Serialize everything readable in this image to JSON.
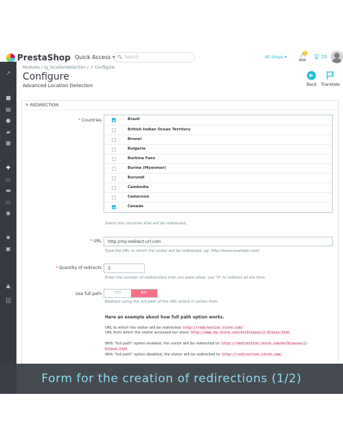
{
  "header": {
    "logo_text": "PrestaShop",
    "quick_access": "Quick Access ▾",
    "search_placeholder": "Search",
    "all_shops": "All shops ▾",
    "notification_count": "2",
    "trophy_count": "25"
  },
  "breadcrumb": "Modules  /  rg_locationdetection  /  ↗ Configure",
  "page": {
    "title": "Configure",
    "subtitle": "Advanced Location Detection",
    "back_label": "Back",
    "translate_label": "Translate"
  },
  "panel": {
    "heading": "REDIRECTION"
  },
  "countries": {
    "label": "Countries",
    "items": [
      {
        "name": "Brazil",
        "checked": true
      },
      {
        "name": "British Indian Ocean Territory",
        "checked": false
      },
      {
        "name": "Brunei",
        "checked": false
      },
      {
        "name": "Bulgaria",
        "checked": false
      },
      {
        "name": "Burkina Faso",
        "checked": false
      },
      {
        "name": "Burma (Myanmar)",
        "checked": false
      },
      {
        "name": "Burundi",
        "checked": false
      },
      {
        "name": "Cambodia",
        "checked": false
      },
      {
        "name": "Cameroon",
        "checked": false
      },
      {
        "name": "Canada",
        "checked": true
      }
    ],
    "help": "Select the countries that will be redirected."
  },
  "url": {
    "label": "URL",
    "value": "http://my-redirect-url.com",
    "help": "Type the URL to which the visitor will be redirected, eg: http://www.example.com/"
  },
  "quantity": {
    "label": "Quantity of redirects",
    "value": "3",
    "help": "Enter the number of redirections that you want allow, use \"0\" to redirect all the time."
  },
  "full_path": {
    "label": "Use full path",
    "yes": "YES",
    "no": "NO",
    "help": "Redirect using the full path of the URL where it comes from."
  },
  "example": {
    "title": "Here an example about how full path option works.",
    "line1_text": "URL to which the visitor will be redirected: ",
    "line1_code": "http://redirection.store.com/",
    "line2_text": "URL from which the visitor accessed our store: ",
    "line2_code": "http://www.my-store.com/en/blouses/2-blouse.html",
    "line3_text": "With \"full path\" option enabled, the visitor will be redirected to: ",
    "line3_code": "http://redirection.store.com/en/blouses/2-",
    "line3_code_cont": "blouse.html",
    "line4_text": "With \"full path\" option disabled, the visitor will be redirected to: ",
    "line4_code": "http://redirection.store.com/"
  },
  "banner": "Form for the creation of redirections (1/2)",
  "colors": {
    "accent": "#25b9d7",
    "sidebar": "#363a41",
    "switch_no": "#f67088",
    "banner_text": "#8fdef0"
  }
}
